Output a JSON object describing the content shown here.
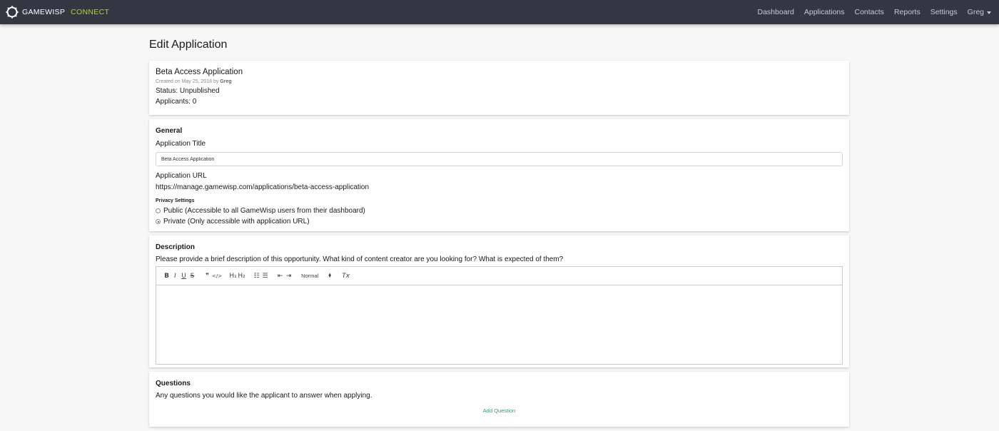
{
  "brand": {
    "name": "GAMEWISP",
    "product": "CONNECT",
    "accent": "#b5d333"
  },
  "nav": {
    "links": [
      "Dashboard",
      "Applications",
      "Contacts",
      "Reports",
      "Settings"
    ],
    "user": "Greg"
  },
  "page": {
    "title": "Edit Application"
  },
  "summary": {
    "name": "Beta Access Application",
    "created_prefix": "Created on May 25, 2018 by",
    "created_by": "Greg",
    "status": "Status: Unpublished",
    "applicants": "Applicants: 0"
  },
  "general": {
    "section": "General",
    "title_label": "Application Title",
    "title_value": "Beta Access Application",
    "url_label": "Application URL",
    "url_value": "https://manage.gamewisp.com/applications/beta-access-application",
    "privacy_label": "Privacy Settings",
    "privacy_options": [
      {
        "label": "Public (Accessible to all GameWisp users from their dashboard)",
        "checked": false
      },
      {
        "label": "Private (Only accessible with application URL)",
        "checked": true
      }
    ]
  },
  "description": {
    "section": "Description",
    "help": "Please provide a brief description of this opportunity. What kind of content creator are you looking for? What is expected of them?",
    "toolbar": {
      "bold": "B",
      "italic": "I",
      "underline": "U",
      "strike": "S",
      "quote": "❞",
      "code": "</>",
      "h1": "H₁",
      "h2": "H₂",
      "ordered_list": "☷",
      "bullet_list": "☰",
      "outdent": "⇤",
      "indent": "⇥",
      "size": "Normal",
      "clear": "Tx"
    }
  },
  "questions": {
    "section": "Questions",
    "help": "Any questions you would like the applicant to answer when applying.",
    "add_label": "Add Question",
    "link_color": "#2f9a7c"
  }
}
